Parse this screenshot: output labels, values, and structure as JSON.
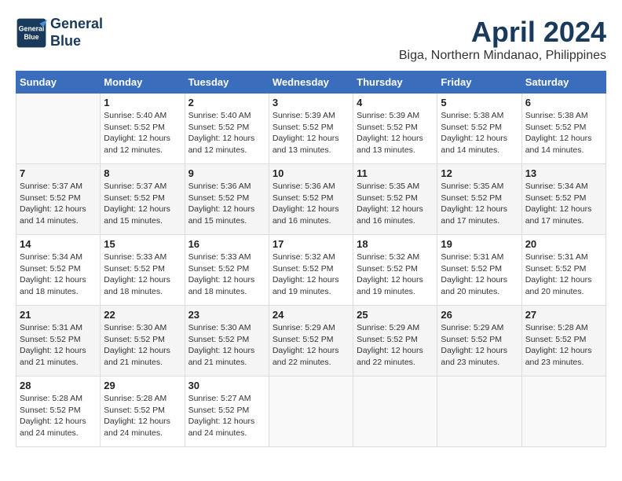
{
  "header": {
    "logo_line1": "General",
    "logo_line2": "Blue",
    "title": "April 2024",
    "subtitle": "Biga, Northern Mindanao, Philippines"
  },
  "calendar": {
    "days_of_week": [
      "Sunday",
      "Monday",
      "Tuesday",
      "Wednesday",
      "Thursday",
      "Friday",
      "Saturday"
    ],
    "weeks": [
      [
        {
          "day": "",
          "info": ""
        },
        {
          "day": "1",
          "info": "Sunrise: 5:40 AM\nSunset: 5:52 PM\nDaylight: 12 hours\nand 12 minutes."
        },
        {
          "day": "2",
          "info": "Sunrise: 5:40 AM\nSunset: 5:52 PM\nDaylight: 12 hours\nand 12 minutes."
        },
        {
          "day": "3",
          "info": "Sunrise: 5:39 AM\nSunset: 5:52 PM\nDaylight: 12 hours\nand 13 minutes."
        },
        {
          "day": "4",
          "info": "Sunrise: 5:39 AM\nSunset: 5:52 PM\nDaylight: 12 hours\nand 13 minutes."
        },
        {
          "day": "5",
          "info": "Sunrise: 5:38 AM\nSunset: 5:52 PM\nDaylight: 12 hours\nand 14 minutes."
        },
        {
          "day": "6",
          "info": "Sunrise: 5:38 AM\nSunset: 5:52 PM\nDaylight: 12 hours\nand 14 minutes."
        }
      ],
      [
        {
          "day": "7",
          "info": "Sunrise: 5:37 AM\nSunset: 5:52 PM\nDaylight: 12 hours\nand 14 minutes."
        },
        {
          "day": "8",
          "info": "Sunrise: 5:37 AM\nSunset: 5:52 PM\nDaylight: 12 hours\nand 15 minutes."
        },
        {
          "day": "9",
          "info": "Sunrise: 5:36 AM\nSunset: 5:52 PM\nDaylight: 12 hours\nand 15 minutes."
        },
        {
          "day": "10",
          "info": "Sunrise: 5:36 AM\nSunset: 5:52 PM\nDaylight: 12 hours\nand 16 minutes."
        },
        {
          "day": "11",
          "info": "Sunrise: 5:35 AM\nSunset: 5:52 PM\nDaylight: 12 hours\nand 16 minutes."
        },
        {
          "day": "12",
          "info": "Sunrise: 5:35 AM\nSunset: 5:52 PM\nDaylight: 12 hours\nand 17 minutes."
        },
        {
          "day": "13",
          "info": "Sunrise: 5:34 AM\nSunset: 5:52 PM\nDaylight: 12 hours\nand 17 minutes."
        }
      ],
      [
        {
          "day": "14",
          "info": "Sunrise: 5:34 AM\nSunset: 5:52 PM\nDaylight: 12 hours\nand 18 minutes."
        },
        {
          "day": "15",
          "info": "Sunrise: 5:33 AM\nSunset: 5:52 PM\nDaylight: 12 hours\nand 18 minutes."
        },
        {
          "day": "16",
          "info": "Sunrise: 5:33 AM\nSunset: 5:52 PM\nDaylight: 12 hours\nand 18 minutes."
        },
        {
          "day": "17",
          "info": "Sunrise: 5:32 AM\nSunset: 5:52 PM\nDaylight: 12 hours\nand 19 minutes."
        },
        {
          "day": "18",
          "info": "Sunrise: 5:32 AM\nSunset: 5:52 PM\nDaylight: 12 hours\nand 19 minutes."
        },
        {
          "day": "19",
          "info": "Sunrise: 5:31 AM\nSunset: 5:52 PM\nDaylight: 12 hours\nand 20 minutes."
        },
        {
          "day": "20",
          "info": "Sunrise: 5:31 AM\nSunset: 5:52 PM\nDaylight: 12 hours\nand 20 minutes."
        }
      ],
      [
        {
          "day": "21",
          "info": "Sunrise: 5:31 AM\nSunset: 5:52 PM\nDaylight: 12 hours\nand 21 minutes."
        },
        {
          "day": "22",
          "info": "Sunrise: 5:30 AM\nSunset: 5:52 PM\nDaylight: 12 hours\nand 21 minutes."
        },
        {
          "day": "23",
          "info": "Sunrise: 5:30 AM\nSunset: 5:52 PM\nDaylight: 12 hours\nand 21 minutes."
        },
        {
          "day": "24",
          "info": "Sunrise: 5:29 AM\nSunset: 5:52 PM\nDaylight: 12 hours\nand 22 minutes."
        },
        {
          "day": "25",
          "info": "Sunrise: 5:29 AM\nSunset: 5:52 PM\nDaylight: 12 hours\nand 22 minutes."
        },
        {
          "day": "26",
          "info": "Sunrise: 5:29 AM\nSunset: 5:52 PM\nDaylight: 12 hours\nand 23 minutes."
        },
        {
          "day": "27",
          "info": "Sunrise: 5:28 AM\nSunset: 5:52 PM\nDaylight: 12 hours\nand 23 minutes."
        }
      ],
      [
        {
          "day": "28",
          "info": "Sunrise: 5:28 AM\nSunset: 5:52 PM\nDaylight: 12 hours\nand 24 minutes."
        },
        {
          "day": "29",
          "info": "Sunrise: 5:28 AM\nSunset: 5:52 PM\nDaylight: 12 hours\nand 24 minutes."
        },
        {
          "day": "30",
          "info": "Sunrise: 5:27 AM\nSunset: 5:52 PM\nDaylight: 12 hours\nand 24 minutes."
        },
        {
          "day": "",
          "info": ""
        },
        {
          "day": "",
          "info": ""
        },
        {
          "day": "",
          "info": ""
        },
        {
          "day": "",
          "info": ""
        }
      ]
    ]
  }
}
